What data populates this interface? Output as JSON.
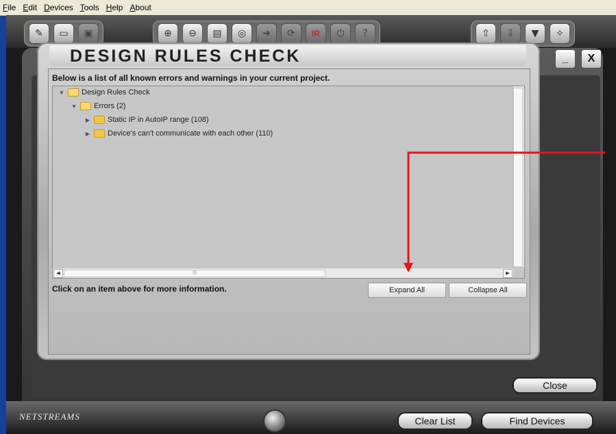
{
  "menu": [
    "File",
    "Edit",
    "Devices",
    "Tools",
    "Help",
    "About"
  ],
  "dialog": {
    "title": "DESIGN RULES CHECK",
    "intro": "Below is a list of all known errors and warnings in your current project.",
    "tree": {
      "root": "Design Rules Check",
      "errors": "Errors (2)",
      "items": [
        "Static IP in AutoIP range (108)",
        "Device's can't communicate with each other (110)"
      ]
    },
    "info": "Click on an item above for more information.",
    "expand_all": "Expand All",
    "collapse_all": "Collapse All",
    "minimize_glyph": "_",
    "close_glyph": "X"
  },
  "toolbar": {
    "ir_label": "IR"
  },
  "footer": {
    "close": "Close",
    "clear_list": "Clear List",
    "find_devices": "Find Devices",
    "brand": "NETSTREAMS"
  },
  "colors": {
    "annotation_arrow": "#e8141c",
    "app_background": "#1a1a1a",
    "left_strip": "#1a3f9a"
  }
}
